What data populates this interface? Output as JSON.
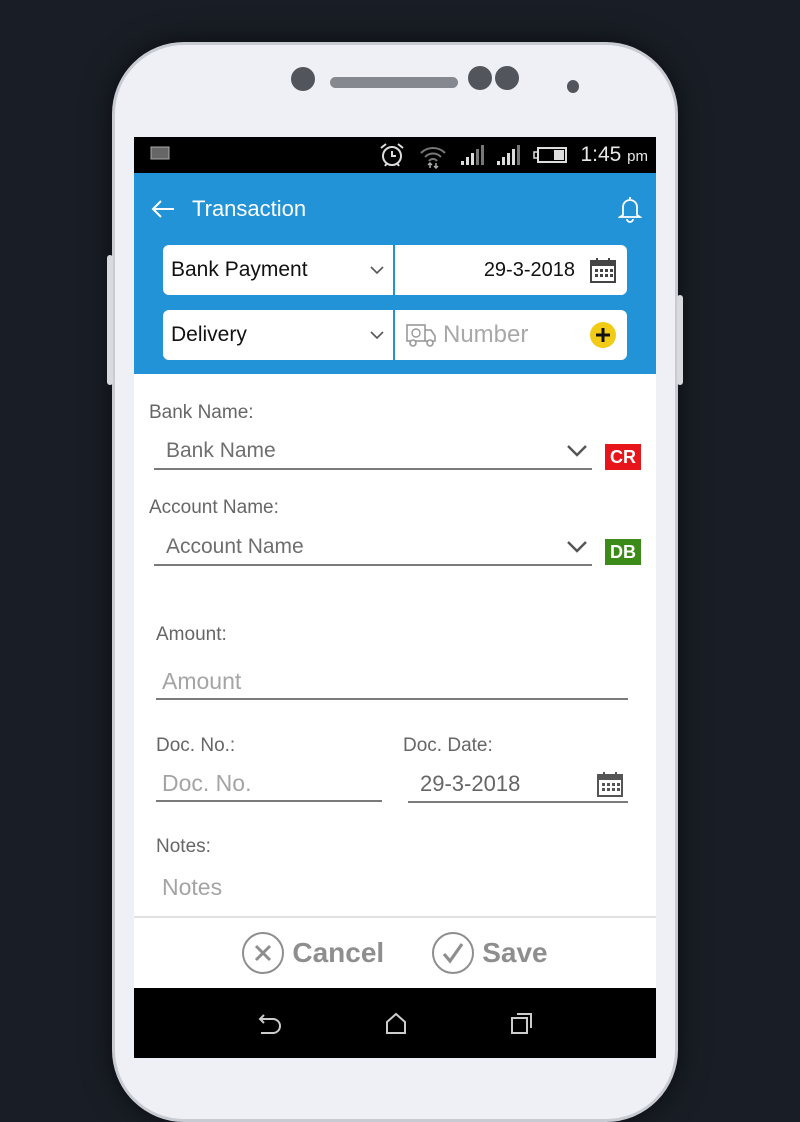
{
  "status_bar": {
    "time": "1:45",
    "ampm": "pm",
    "icons": [
      "notification-icon",
      "alarm-icon",
      "wifi-icon",
      "signal-icon",
      "signal-icon",
      "battery-icon"
    ]
  },
  "app_bar": {
    "title": "Transaction",
    "back_icon": "arrow-left-icon",
    "notification_icon": "bell-icon",
    "color": "#2193d6"
  },
  "header_fields": {
    "type_select": "Bank Payment",
    "date": "29-3-2018",
    "mode_select": "Delivery",
    "number_placeholder": "Number"
  },
  "form": {
    "bank_label": "Bank Name:",
    "bank_placeholder": "Bank Name",
    "bank_badge": "CR",
    "bank_badge_color": "#e8141c",
    "account_label": "Account Name:",
    "account_placeholder": "Account Name",
    "account_badge": "DB",
    "account_badge_color": "#3c8a17",
    "amount_label": "Amount:",
    "amount_placeholder": "Amount",
    "docno_label": "Doc. No.:",
    "docno_placeholder": "Doc. No.",
    "docdate_label": "Doc. Date:",
    "docdate_value": "29-3-2018",
    "notes_label": "Notes:",
    "notes_placeholder": "Notes"
  },
  "actions": {
    "cancel": "Cancel",
    "save": "Save"
  },
  "nav_bar": {
    "icons": [
      "back-icon",
      "home-icon",
      "recents-icon"
    ]
  }
}
